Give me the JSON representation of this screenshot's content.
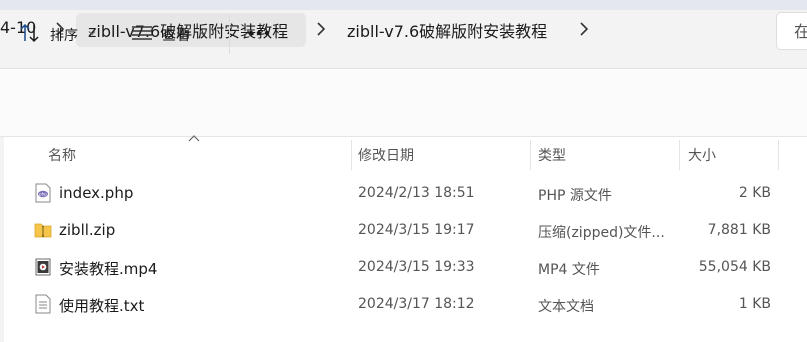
{
  "breadcrumb": {
    "items": [
      "4-10",
      "zibll-v7.6破解版附安装教程",
      "zibll-v7.6破解版附安装教程"
    ]
  },
  "search": {
    "text": "在"
  },
  "toolbar": {
    "sort_label": "排序",
    "view_label": "查看",
    "more_label": "•••"
  },
  "columns": {
    "name": "名称",
    "date": "修改日期",
    "type": "类型",
    "size": "大小"
  },
  "files": [
    {
      "name": "index.php",
      "date": "2024/2/13 18:51",
      "type": "PHP 源文件",
      "size": "2 KB",
      "icon": "php-file-icon"
    },
    {
      "name": "zibll.zip",
      "date": "2024/3/15 19:17",
      "type": "压缩(zipped)文件...",
      "size": "7,881 KB",
      "icon": "zip-folder-icon"
    },
    {
      "name": "安装教程.mp4",
      "date": "2024/3/15 19:33",
      "type": "MP4 文件",
      "size": "55,054 KB",
      "icon": "video-file-icon"
    },
    {
      "name": "使用教程.txt",
      "date": "2024/3/17 18:12",
      "type": "文本文档",
      "size": "1 KB",
      "icon": "text-file-icon"
    }
  ]
}
